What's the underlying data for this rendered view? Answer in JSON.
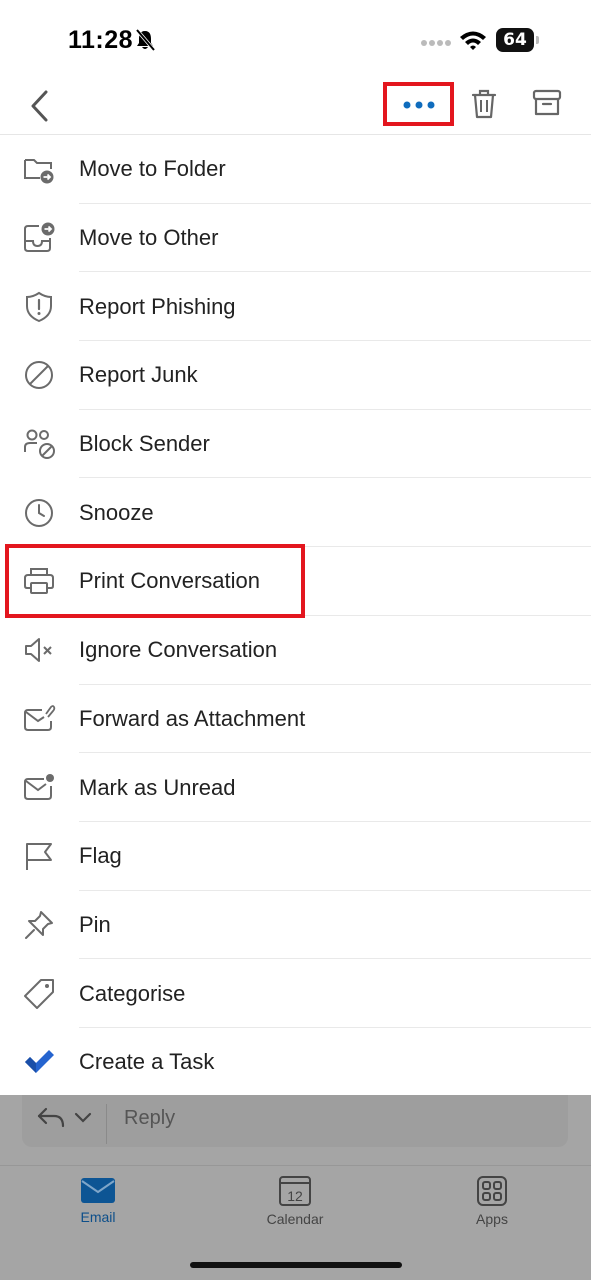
{
  "status_bar": {
    "time": "11:28",
    "battery": "64"
  },
  "menu": {
    "items": [
      {
        "label": "Move to Folder",
        "icon": "folder-move-icon"
      },
      {
        "label": "Move to Other",
        "icon": "inbox-move-icon"
      },
      {
        "label": "Report Phishing",
        "icon": "shield-alert-icon"
      },
      {
        "label": "Report Junk",
        "icon": "prohibited-icon"
      },
      {
        "label": "Block Sender",
        "icon": "block-person-icon"
      },
      {
        "label": "Snooze",
        "icon": "clock-icon"
      },
      {
        "label": "Print Conversation",
        "icon": "printer-icon"
      },
      {
        "label": "Ignore Conversation",
        "icon": "speaker-mute-icon"
      },
      {
        "label": "Forward as Attachment",
        "icon": "mail-attach-icon"
      },
      {
        "label": "Mark as Unread",
        "icon": "mail-unread-icon"
      },
      {
        "label": "Flag",
        "icon": "flag-icon"
      },
      {
        "label": "Pin",
        "icon": "pin-icon"
      },
      {
        "label": "Categorise",
        "icon": "tag-icon"
      },
      {
        "label": "Create a Task",
        "icon": "todo-check-icon"
      }
    ]
  },
  "reply": {
    "placeholder": "Reply"
  },
  "tabs": [
    {
      "label": "Email",
      "icon": "mail-icon",
      "active": true
    },
    {
      "label": "Calendar",
      "icon": "calendar-icon",
      "day": "12"
    },
    {
      "label": "Apps",
      "icon": "apps-grid-icon"
    }
  ],
  "colors": {
    "accent": "#0f6cbd",
    "highlight": "#e3161e",
    "icon_gray": "#6b6b6b",
    "task_blue": "#2564cf"
  }
}
